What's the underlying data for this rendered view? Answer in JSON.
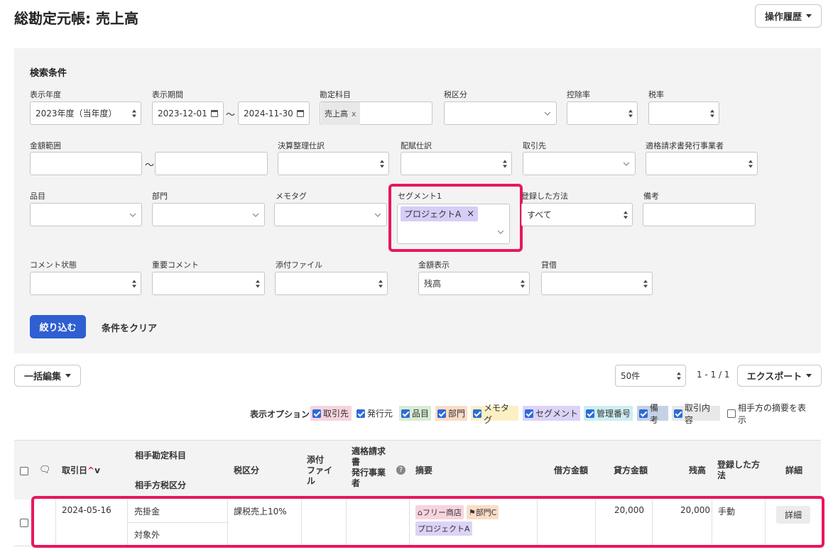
{
  "header": {
    "title": "総勘定元帳: 売上高",
    "history_button": "操作履歴"
  },
  "search": {
    "title": "検索条件",
    "fiscal_year": {
      "label": "表示年度",
      "value": "2023年度（当年度）"
    },
    "period": {
      "label": "表示期間",
      "from": "2023-12-01",
      "separator": "〜",
      "to": "2024-11-30"
    },
    "account": {
      "label": "勘定科目",
      "tag": "売上高",
      "remove": "x"
    },
    "tax_category": {
      "label": "税区分",
      "value": ""
    },
    "deduction_rate": {
      "label": "控除率",
      "value": ""
    },
    "tax_rate": {
      "label": "税率",
      "value": ""
    },
    "amount_range": {
      "label": "金額範囲",
      "separator": "〜"
    },
    "closing_entry": {
      "label": "決算整理仕訳",
      "value": ""
    },
    "allocation_entry": {
      "label": "配賦仕訳",
      "value": ""
    },
    "partner": {
      "label": "取引先",
      "value": ""
    },
    "qualified_issuer": {
      "label": "適格請求書発行事業者",
      "value": ""
    },
    "item": {
      "label": "品目",
      "value": ""
    },
    "department": {
      "label": "部門",
      "value": ""
    },
    "memo_tag": {
      "label": "メモタグ",
      "value": ""
    },
    "segment1": {
      "label": "セグメント1",
      "tag": "プロジェクトA",
      "remove": "×"
    },
    "registration_method": {
      "label": "登録した方法",
      "value": "すべて"
    },
    "remarks": {
      "label": "備考",
      "value": ""
    },
    "comment_status": {
      "label": "コメント状態",
      "value": ""
    },
    "important_comment": {
      "label": "重要コメント",
      "value": ""
    },
    "attachment": {
      "label": "添付ファイル",
      "value": ""
    },
    "amount_display": {
      "label": "金額表示",
      "value": "残高"
    },
    "debit_credit": {
      "label": "貸借",
      "value": ""
    },
    "filter_button": "絞り込む",
    "clear_button": "条件をクリア"
  },
  "toolbar": {
    "bulk_edit": "一括編集",
    "per_page": "50件",
    "pagination": "1 - 1 / 1",
    "export": "エクスポート"
  },
  "display_options": {
    "label": "表示オプション",
    "items": [
      {
        "label": "取引先",
        "checked": true,
        "color": "#f7d4dd"
      },
      {
        "label": "発行元",
        "checked": true,
        "color": "#ffffff"
      },
      {
        "label": "品目",
        "checked": true,
        "color": "#d8ecd3"
      },
      {
        "label": "部門",
        "checked": true,
        "color": "#fbdcc8"
      },
      {
        "label": "メモタグ",
        "checked": true,
        "color": "#fbf0c4"
      },
      {
        "label": "セグメント",
        "checked": true,
        "color": "#dcd3f7"
      },
      {
        "label": "管理番号",
        "checked": true,
        "color": "#cdeef0"
      },
      {
        "label": "備考",
        "checked": true,
        "color": "#c5d2e4"
      },
      {
        "label": "取引内容",
        "checked": true,
        "color": "#e8e8e8"
      },
      {
        "label": "相手方の摘要を表示",
        "checked": false,
        "color": "#ffffff"
      }
    ]
  },
  "table": {
    "headers": {
      "date": "取引日",
      "counter_account": "相手勘定科目",
      "counter_tax": "相手方税区分",
      "tax_category": "税区分",
      "attachment_1": "添付",
      "attachment_2": "ファイ",
      "attachment_3": "ル",
      "issuer_1": "適格請求",
      "issuer_2": "書",
      "issuer_3": "発行事業",
      "issuer_4": "者",
      "description": "摘要",
      "debit": "借方金額",
      "credit": "貸方金額",
      "balance": "残高",
      "method_1": "登録した方",
      "method_2": "法",
      "detail": "詳細"
    },
    "rows": [
      {
        "date": "2024-05-16",
        "counter_account": "売掛金",
        "counter_tax": "対象外",
        "tax_category": "課税売上10%",
        "partner_tag": "フリー商店",
        "department_tag": "部門C",
        "segment_tag": "プロジェクトA",
        "debit": "",
        "credit": "20,000",
        "balance": "20,000",
        "method": "手動",
        "detail_button": "詳細"
      }
    ]
  },
  "colors": {
    "accent": "#2f5fd1",
    "highlight": "#e8175d",
    "segment_tag": "#d7cdf7"
  }
}
